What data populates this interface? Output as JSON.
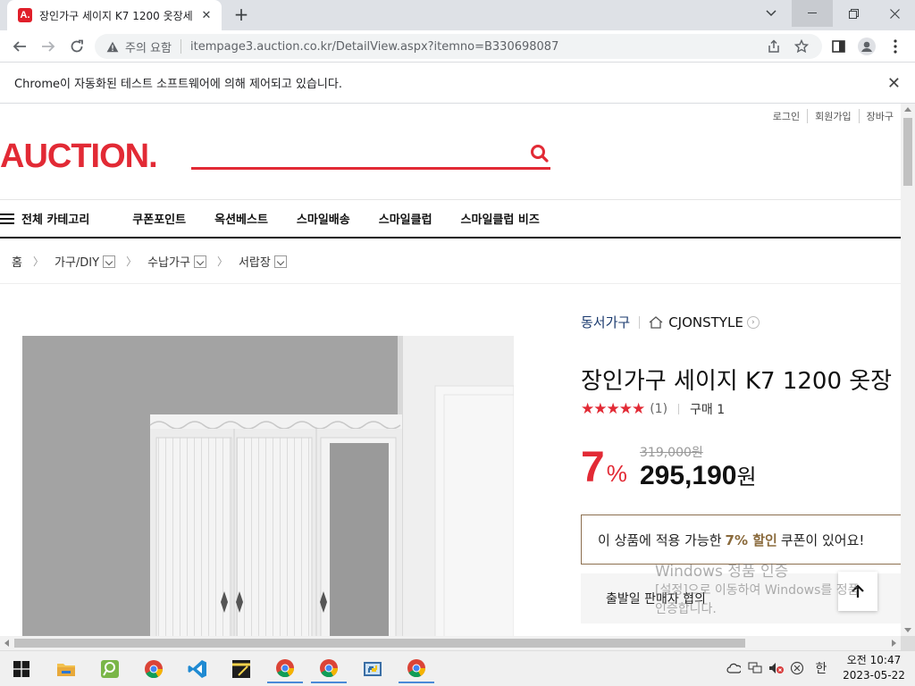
{
  "browser": {
    "tab_title": "장인가구 세이지 K7 1200 옷장세",
    "favicon_letter": "A.",
    "security_label": "주의 요함",
    "url": "itempage3.auction.co.kr/DetailView.aspx?itemno=B330698087",
    "infobar_text": "Chrome이 자동화된 테스트 소프트웨어에 의해 제어되고 있습니다."
  },
  "page": {
    "util_links": [
      "로그인",
      "회원가입",
      "장바구"
    ],
    "logo": "AUCTION.",
    "gnb": {
      "all_categories": "전체 카테고리",
      "items": [
        "쿠폰포인트",
        "옥션베스트",
        "스마일배송",
        "스마일클럽",
        "스마일클럽 비즈"
      ]
    },
    "breadcrumb": [
      "홈",
      "가구/DIY",
      "수납가구",
      "서랍장"
    ],
    "product": {
      "seller": "동서가구",
      "store": "CJONSTYLE",
      "title": "장인가구 세이지 K7 1200 옷장",
      "stars": "★★★★★",
      "rating_value": 5,
      "review_count": "(1)",
      "purchase_count": "구매 1",
      "discount_rate": "7",
      "discount_unit": "%",
      "original_price": "319,000원",
      "sale_price": "295,190",
      "sale_unit": "원",
      "coupon_before": "이 상품에 적용 가능한",
      "coupon_highlight": "7% 할인",
      "coupon_after": "쿠폰이 있어요!",
      "shipping_text": "출발일 판매자 협의"
    },
    "watermark": {
      "line1": "Windows 정품 인증",
      "line2": "[설정]으로 이동하여 Windows를 정품",
      "line3": "인증합니다."
    }
  },
  "taskbar": {
    "time": "오전 10:47",
    "date": "2023-05-22",
    "ime": "한"
  },
  "colors": {
    "brand_red": "#e22a35",
    "coupon_gold": "#8a6a3c",
    "seller_navy": "#1a3a6e"
  }
}
